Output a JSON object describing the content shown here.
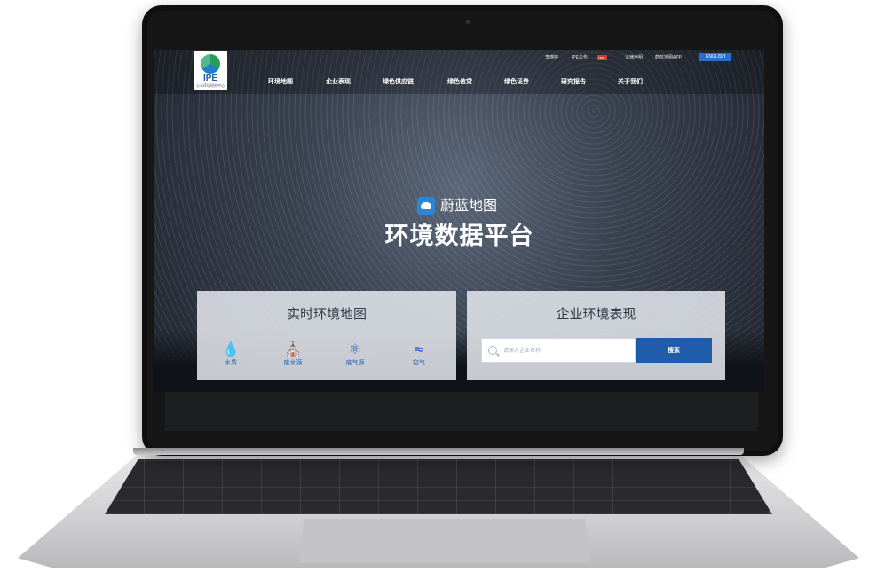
{
  "nav": {
    "logo_text": "IPE",
    "logo_sub": "公众环境研究中心",
    "utility": {
      "user": "李瑛婷",
      "announcement": "IPE公告",
      "new_badge": "NEW",
      "legal": "法律声明",
      "app": "蔚蓝地图APP",
      "english": "ENGLISH"
    },
    "menu": [
      "环境地图",
      "企业表现",
      "绿色供应链",
      "绿色信贷",
      "绿色证券",
      "研究报告",
      "关于我们"
    ]
  },
  "hero": {
    "brand": "蔚蓝地图",
    "title": "环境数据平台"
  },
  "cards": {
    "left": {
      "title": "实时环境地图",
      "items": [
        {
          "label": "水质",
          "icon": "water-drop-icon"
        },
        {
          "label": "废水源",
          "icon": "factory-icon"
        },
        {
          "label": "废气源",
          "icon": "gas-source-icon"
        },
        {
          "label": "空气",
          "icon": "air-waves-icon"
        }
      ]
    },
    "right": {
      "title": "企业环境表现",
      "search_placeholder": "请输入企业名称",
      "search_button": "搜索"
    }
  },
  "colors": {
    "accent": "#1f5ca9",
    "english_button": "#2a6fd0",
    "new_badge": "#d6392f",
    "icon_blue": "#2a63b8"
  }
}
